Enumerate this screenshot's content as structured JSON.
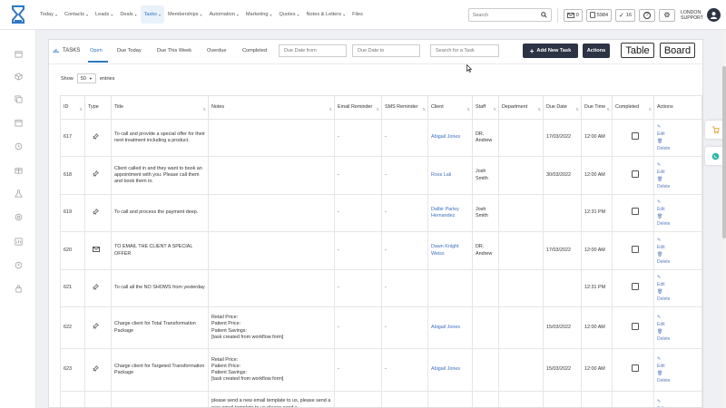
{
  "nav": {
    "items": [
      {
        "label": "Today",
        "caret": true
      },
      {
        "label": "Contacts",
        "caret": true
      },
      {
        "label": "Leads",
        "caret": true
      },
      {
        "label": "Deals",
        "caret": true
      },
      {
        "label": "Tasks",
        "caret": true
      },
      {
        "label": "Memberships",
        "caret": true
      },
      {
        "label": "Automation",
        "caret": true
      },
      {
        "label": "Marketing",
        "caret": true
      },
      {
        "label": "Quotes",
        "caret": true
      },
      {
        "label": "Notes & Letters",
        "caret": true
      },
      {
        "label": "Files",
        "caret": false
      }
    ],
    "active_index": 4,
    "search_placeholder": "Search",
    "mail_count": "0",
    "phone_count": "5984",
    "task_count": "16",
    "user_line1": "LONDON",
    "user_line2": "SUPPORT"
  },
  "toolbar": {
    "title": "TASKS",
    "tabs": [
      "Open",
      "Due Today",
      "Due This Week",
      "Overdue",
      "Completed"
    ],
    "active_tab": "Open",
    "due_from_placeholder": "Due Date from",
    "due_to_placeholder": "Due Date to",
    "search_placeholder": "Search for a Task",
    "add_button": "Add New Task",
    "actions_button": "Actions",
    "table_button": "Table",
    "board_button": "Board"
  },
  "show": {
    "prefix": "Show",
    "value": "50",
    "suffix": "entries"
  },
  "table": {
    "headers": [
      "ID",
      "Type",
      "Title",
      "Notes",
      "Email Reminder",
      "SMS Reminder",
      "Client",
      "Staff",
      "Department",
      "Due Date",
      "Due Time",
      "Completed",
      "Actions"
    ],
    "edit_label": "Edit",
    "delete_label": "Delete",
    "rows": [
      {
        "id": "617",
        "type": "pin",
        "title": "To call and provide a special offer for their next treatment including a product.",
        "notes": "",
        "email": "-",
        "sms": "-",
        "client": "Abigail Jones",
        "staff": "DR. Andrew",
        "department": "",
        "due_date": "17/03/2022",
        "due_time": "12:00 AM"
      },
      {
        "id": "618",
        "type": "pin",
        "title": "Client called in and they want to book an appointment with you. Please call them and book them in.",
        "notes": "",
        "email": "-",
        "sms": "-",
        "client": "Ross Lali",
        "staff": "Josh Smith",
        "department": "",
        "due_date": "30/03/2022",
        "due_time": "12:00 AM"
      },
      {
        "id": "619",
        "type": "pin",
        "title": "To call and process the payment deep.",
        "notes": "",
        "email": "-",
        "sms": "-",
        "client": "Dalbir Parley Hernandez",
        "staff": "Josh Smith",
        "department": "",
        "due_date": "",
        "due_time": "12:31 PM"
      },
      {
        "id": "620",
        "type": "mail",
        "title": "TO EMAIL THE CLIENT A SPECIAL OFFER",
        "notes": "",
        "email": "-",
        "sms": "-",
        "client": "Dawn Knight Weiss",
        "staff": "DR. Andrew",
        "department": "",
        "due_date": "17/03/2022",
        "due_time": "12:00 AM"
      },
      {
        "id": "621",
        "type": "pin",
        "title": "To call all the NO SHOWS from yesterday",
        "notes": "",
        "email": "-",
        "sms": "-",
        "client": "",
        "staff": "",
        "department": "",
        "due_date": "",
        "due_time": "12:31 PM"
      },
      {
        "id": "622",
        "type": "pin",
        "title": "Charge client for Total Transformation Package",
        "notes": "Retail Price:\nPatient Price:\nPatient Savings:\n[task created from workflow form]",
        "email": "-",
        "sms": "-",
        "client": "Abigail Jones",
        "staff": "",
        "department": "",
        "due_date": "15/03/2022",
        "due_time": "12:00 AM"
      },
      {
        "id": "623",
        "type": "pin",
        "title": "Charge client for Targeted Transformation Package",
        "notes": "Retail Price:\nPatient Price:\nPatient Savings:\n[task created from workflow form]",
        "email": "-",
        "sms": "-",
        "client": "Abigail Jones",
        "staff": "",
        "department": "",
        "due_date": "15/03/2022",
        "due_time": "12:00 AM"
      },
      {
        "id": "",
        "type": "",
        "title": "",
        "notes": "please send a new email template to us, please send a new email template to us please send a",
        "email": "",
        "sms": "",
        "client": "",
        "staff": "",
        "department": "",
        "due_date": "",
        "due_time": ""
      }
    ]
  },
  "colors": {
    "accent": "#2f78c4",
    "dark_button": "#2c3344",
    "link": "#3a6fc0"
  }
}
